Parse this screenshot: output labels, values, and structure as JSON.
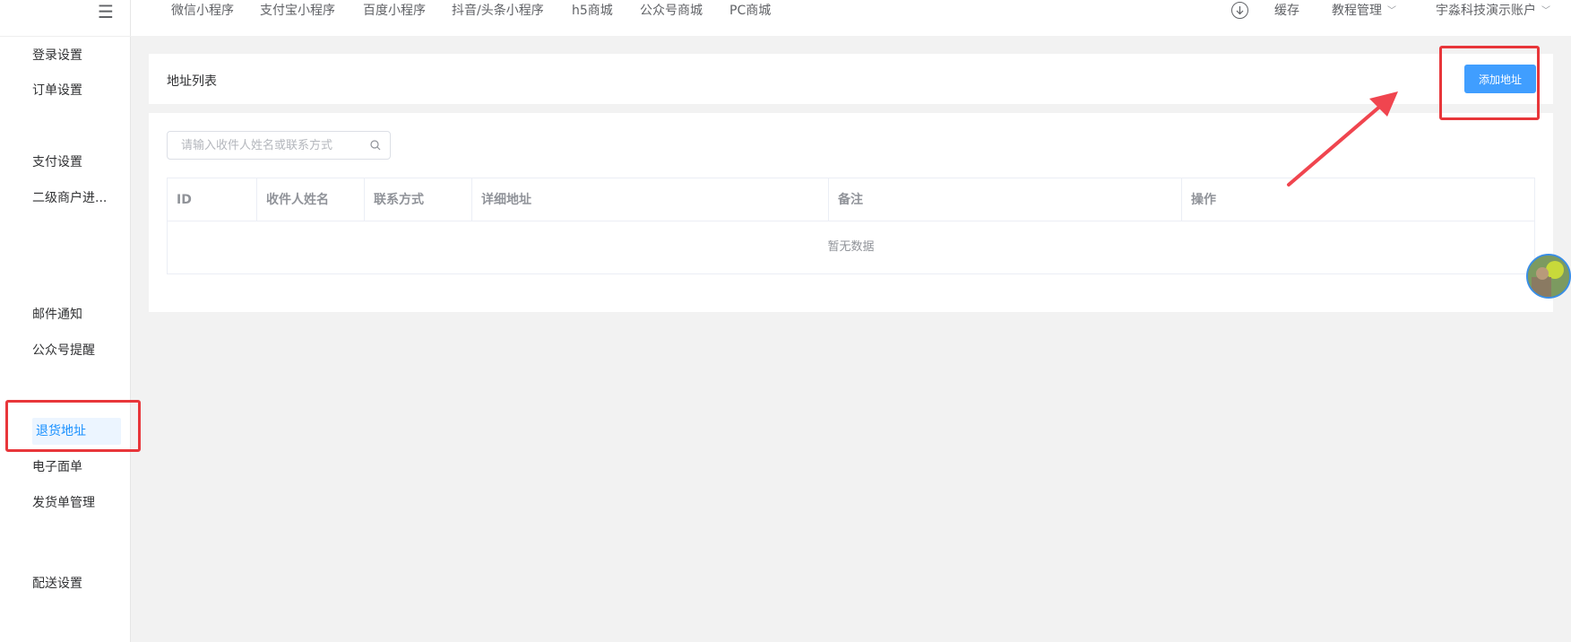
{
  "top_nav": {
    "tabs": [
      "微信小程序",
      "支付宝小程序",
      "百度小程序",
      "抖音/头条小程序",
      "h5商城",
      "公众号商城",
      "PC商城"
    ],
    "cache_label": "缓存",
    "tutorial_label": "教程管理",
    "account_label": "宇淼科技演示账户",
    "download_icon": "download-icon"
  },
  "sidebar": {
    "collapse_icon": "menu-collapse-icon",
    "items": [
      "登录设置",
      "订单设置",
      "支付设置",
      "二级商户进...",
      "邮件通知",
      "公众号提醒",
      "退货地址",
      "电子面单",
      "发货单管理",
      "配送设置"
    ],
    "active_item": "退货地址"
  },
  "header_card": {
    "title": "地址列表",
    "add_button_label": "添加地址"
  },
  "search": {
    "placeholder": "请输入收件人姓名或联系方式",
    "value": ""
  },
  "table": {
    "columns": [
      "ID",
      "收件人姓名",
      "联系方式",
      "详细地址",
      "备注",
      "操作"
    ],
    "rows": [],
    "empty_text": "暂无数据"
  },
  "colors": {
    "primary": "#409eff",
    "annotation_red": "#e8363a",
    "active_menu_bg": "#ecf5ff"
  }
}
